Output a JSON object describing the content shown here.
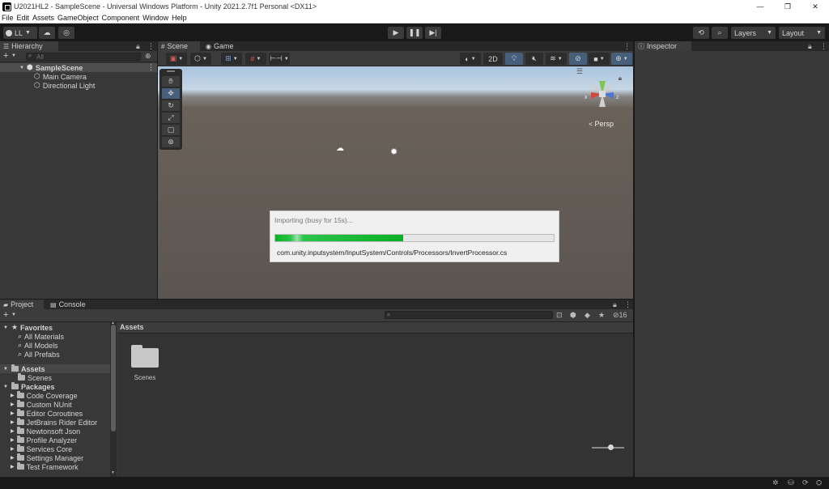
{
  "window": {
    "title": "U2021HL2 - SampleScene - Universal Windows Platform - Unity 2021.2.7f1 Personal <DX11>",
    "minimize": "—",
    "maximize": "❐",
    "close": "✕"
  },
  "menu": [
    "File",
    "Edit",
    "Assets",
    "GameObject",
    "Component",
    "Window",
    "Help"
  ],
  "toolbar": {
    "account": "LL",
    "layers": "Layers",
    "layout": "Layout"
  },
  "hierarchy": {
    "tab": "Hierarchy",
    "search_placeholder": "All",
    "scene": "SampleScene",
    "items": [
      "Main Camera",
      "Directional Light"
    ]
  },
  "scene": {
    "tabs": [
      "Scene",
      "Game"
    ],
    "mode_2d": "2D",
    "persp_label": "Persp",
    "gizmo_x": "x",
    "gizmo_z": "z"
  },
  "progress": {
    "title": "Importing (busy for 15s)...",
    "percent": 46,
    "message": "com.unity.inputsystem/InputSystem/Controls/Processors/InvertProcessor.cs"
  },
  "inspector": {
    "tab": "Inspector"
  },
  "project": {
    "tabs": [
      "Project",
      "Console"
    ],
    "hidden_count": "16",
    "breadcrumb": "Assets",
    "favorites_label": "Favorites",
    "favorites": [
      "All Materials",
      "All Models",
      "All Prefabs"
    ],
    "assets_label": "Assets",
    "assets_children": [
      "Scenes"
    ],
    "packages_label": "Packages",
    "packages": [
      "Code Coverage",
      "Custom NUnit",
      "Editor Coroutines",
      "JetBrains Rider Editor",
      "Newtonsoft Json",
      "Profile Analyzer",
      "Services Core",
      "Settings Manager",
      "Test Framework"
    ],
    "grid_items": [
      "Scenes"
    ]
  }
}
